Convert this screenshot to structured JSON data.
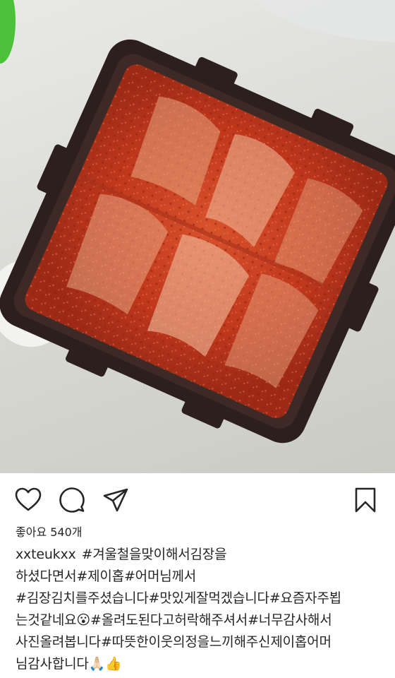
{
  "post": {
    "likes_label": "좋아요 540개",
    "username": "xxteukxx",
    "caption_lines": [
      "#겨울철을맞이해서김장을",
      "하셨다면서#제이홉#어머님께서",
      "#김장김치를주셨습니다#맛있게잘먹겠습니다#요즘자주뵙",
      "는것같네요😮#올려도된다고허락해주셔서#너무감사해서",
      "사진올려봅니다#따뜻한이웃의정을느끼해주신제이홉어머",
      "님감사합니다🙏🏻👍"
    ]
  },
  "icons": {
    "like": "heart-icon",
    "comment": "comment-icon",
    "share": "share-icon",
    "save": "bookmark-icon"
  },
  "colors": {
    "text": "#262626",
    "kimchi": "#c2391f",
    "container": "#2c1f1e"
  }
}
